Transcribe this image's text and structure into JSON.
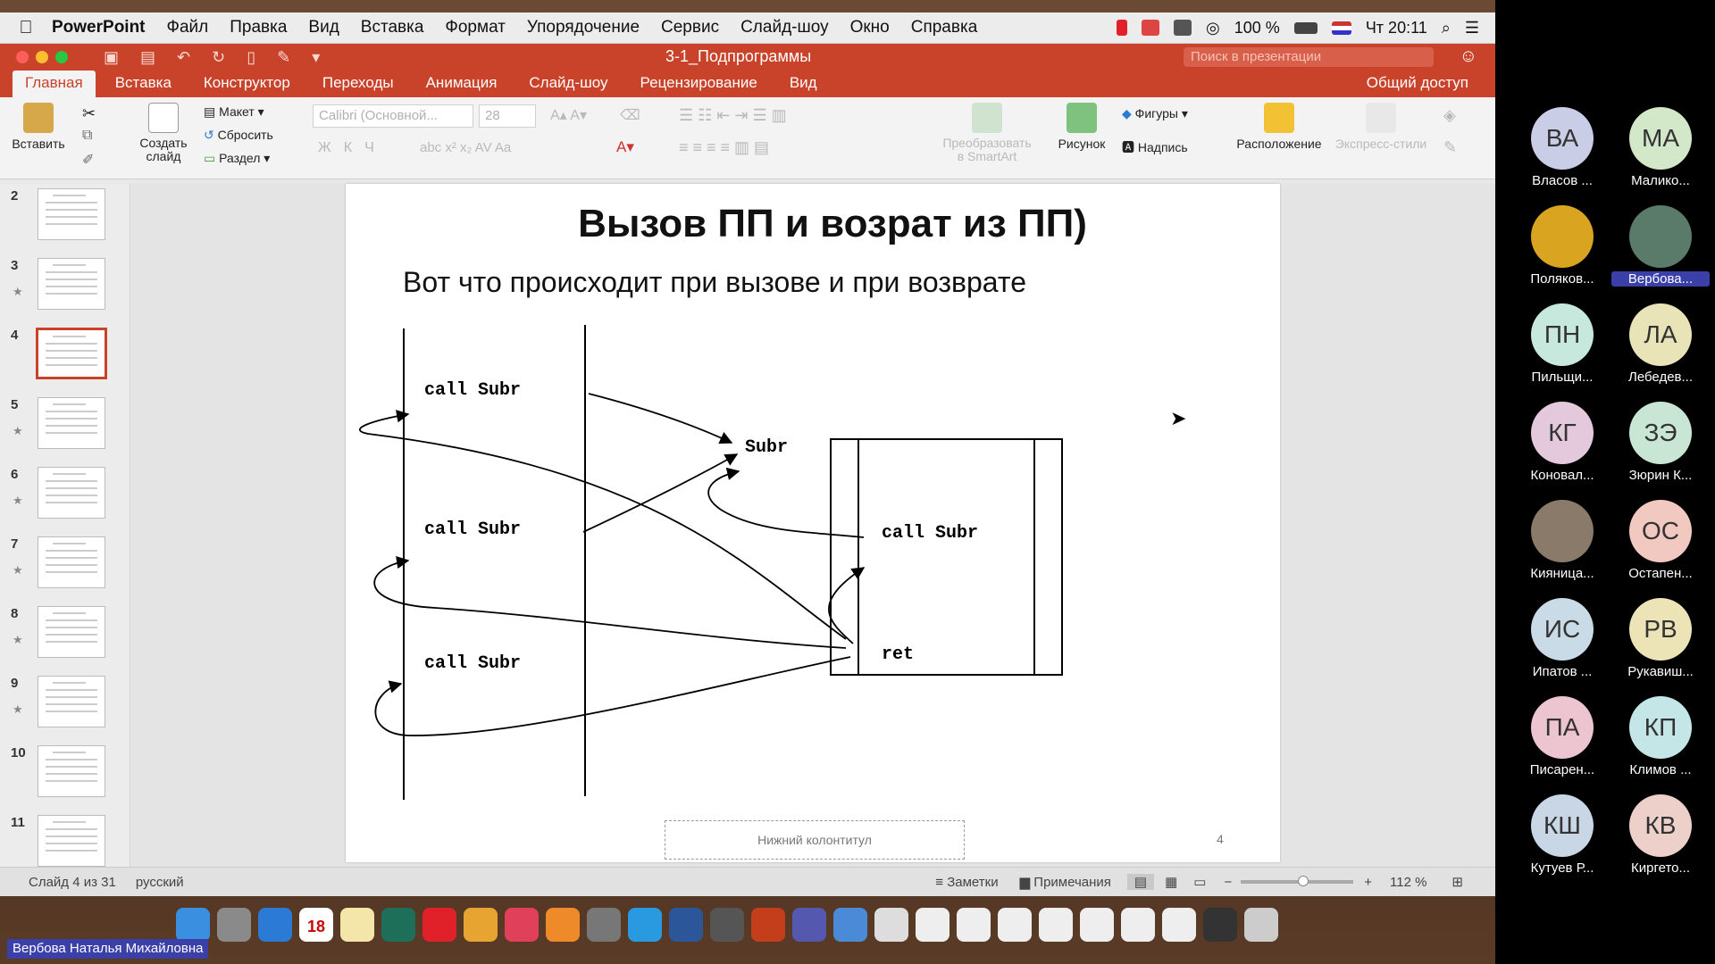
{
  "menubar": {
    "app": "PowerPoint",
    "items": [
      "Файл",
      "Правка",
      "Вид",
      "Вставка",
      "Формат",
      "Упорядочение",
      "Сервис",
      "Слайд-шоу",
      "Окно",
      "Справка"
    ],
    "battery": "100 %",
    "clock": "Чт 20:11"
  },
  "window": {
    "title": "3-1_Подпрограммы",
    "search_placeholder": "Поиск в презентации"
  },
  "ribbon_tabs": [
    "Главная",
    "Вставка",
    "Конструктор",
    "Переходы",
    "Анимация",
    "Слайд-шоу",
    "Рецензирование",
    "Вид"
  ],
  "share_label": "Общий доступ",
  "ribbon": {
    "paste": "Вставить",
    "new_slide": "Создать слайд",
    "layout": "Макет",
    "reset": "Сбросить",
    "section": "Раздел",
    "font_name": "Calibri (Основной...",
    "font_size": "28",
    "smartart": "Преобразовать в SmartArt",
    "picture": "Рисунок",
    "shapes": "Фигуры",
    "textbox": "Надпись",
    "arrange": "Расположение",
    "quick_styles": "Экспресс-стили"
  },
  "thumbnails": [
    {
      "num": "2",
      "star": false
    },
    {
      "num": "3",
      "star": true
    },
    {
      "num": "4",
      "star": false,
      "selected": true
    },
    {
      "num": "5",
      "star": true
    },
    {
      "num": "6",
      "star": true
    },
    {
      "num": "7",
      "star": true
    },
    {
      "num": "8",
      "star": true
    },
    {
      "num": "9",
      "star": true
    },
    {
      "num": "10",
      "star": false
    },
    {
      "num": "11",
      "star": false
    }
  ],
  "slide": {
    "title": "Вызов ПП и возрат из ПП)",
    "subtitle": "Вот что происходит при вызове и при возврате",
    "call1": "call Subr",
    "call2": "call Subr",
    "call3": "call Subr",
    "subr_label": "Subr",
    "inner_call": "call Subr",
    "ret": "ret",
    "footer": "Нижний колонтитул",
    "page_num": "4"
  },
  "status": {
    "slide_of": "Слайд 4 из 31",
    "language": "русский",
    "notes": "Заметки",
    "comments": "Примечания",
    "zoom": "112 %"
  },
  "dock_calendar": "18",
  "active_speaker": "Вербова Наталья Михайловна",
  "participants": [
    {
      "initials": "ВА",
      "name": "Власов ...",
      "color": "#c9cde6"
    },
    {
      "initials": "МА",
      "name": "Малико...",
      "color": "#d3e8c8"
    },
    {
      "initials": "",
      "name": "Поляков...",
      "color": "#d9a520"
    },
    {
      "initials": "",
      "name": "Вербова...",
      "color": "#5a7a6a",
      "active": true
    },
    {
      "initials": "ПН",
      "name": "Пильщи...",
      "color": "#c7e8dd"
    },
    {
      "initials": "ЛА",
      "name": "Лебедев...",
      "color": "#e8e4b8"
    },
    {
      "initials": "КГ",
      "name": "Коновал...",
      "color": "#e4c9dc"
    },
    {
      "initials": "ЗЭ",
      "name": "Зюрин К...",
      "color": "#c9e6d5"
    },
    {
      "initials": "",
      "name": "Кияница...",
      "color": "#8a7a6a"
    },
    {
      "initials": "ОС",
      "name": "Остапен...",
      "color": "#f1c9c0"
    },
    {
      "initials": "ИС",
      "name": "Ипатов ...",
      "color": "#c9dbe6"
    },
    {
      "initials": "РВ",
      "name": "Рукавиш...",
      "color": "#ece3b6"
    },
    {
      "initials": "ПА",
      "name": "Писарен...",
      "color": "#ecc5d0"
    },
    {
      "initials": "КП",
      "name": "Климов ...",
      "color": "#c5e6e6"
    },
    {
      "initials": "КШ",
      "name": "Кутуев Р...",
      "color": "#c9d6e6"
    },
    {
      "initials": "КВ",
      "name": "Киргето...",
      "color": "#ecd0c9"
    }
  ]
}
